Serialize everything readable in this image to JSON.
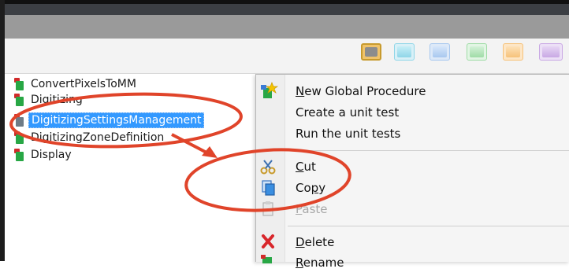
{
  "tree": {
    "items": [
      {
        "label": "ConvertPixelsToMM",
        "icon": "global-procedure-icon"
      },
      {
        "label": "Digitizing",
        "icon": "global-procedure-icon"
      },
      {
        "label": "DigitizingSettingsManagement",
        "icon": "global-procedure-icon",
        "selected": true
      },
      {
        "label": "DigitizingZoneDefinition",
        "icon": "global-procedure-icon"
      },
      {
        "label": "Display",
        "icon": "global-procedure-icon"
      }
    ]
  },
  "context_menu": {
    "items": [
      {
        "label": "New Global Procedure",
        "underline": "N",
        "icon": "new-procedure-icon",
        "enabled": true
      },
      {
        "label": "Create a unit test",
        "enabled": true
      },
      {
        "label": "Run the unit tests",
        "enabled": true
      },
      {
        "label": "Cut",
        "underline": "C",
        "icon": "scissors-icon",
        "enabled": true
      },
      {
        "label": "Copy",
        "underline": "p",
        "icon": "copy-icon",
        "enabled": true
      },
      {
        "label": "Paste",
        "underline": "P",
        "icon": "paste-icon",
        "enabled": false
      },
      {
        "label": "Delete",
        "underline": "D",
        "icon": "delete-icon",
        "enabled": true
      },
      {
        "label": "Rename",
        "underline": "R",
        "icon": "rename-icon",
        "enabled": true
      }
    ]
  },
  "toolbar": {
    "swatches": [
      {
        "name": "grey",
        "color": "#8c8c8c",
        "active": true
      },
      {
        "name": "cyan",
        "color": "#8fd6e8"
      },
      {
        "name": "blue",
        "color": "#a8c8ef"
      },
      {
        "name": "green",
        "color": "#9fdca6"
      },
      {
        "name": "orange",
        "color": "#f6c27a"
      },
      {
        "name": "purple",
        "color": "#c9a8e4"
      }
    ]
  },
  "annotation_color": "#e0442a"
}
